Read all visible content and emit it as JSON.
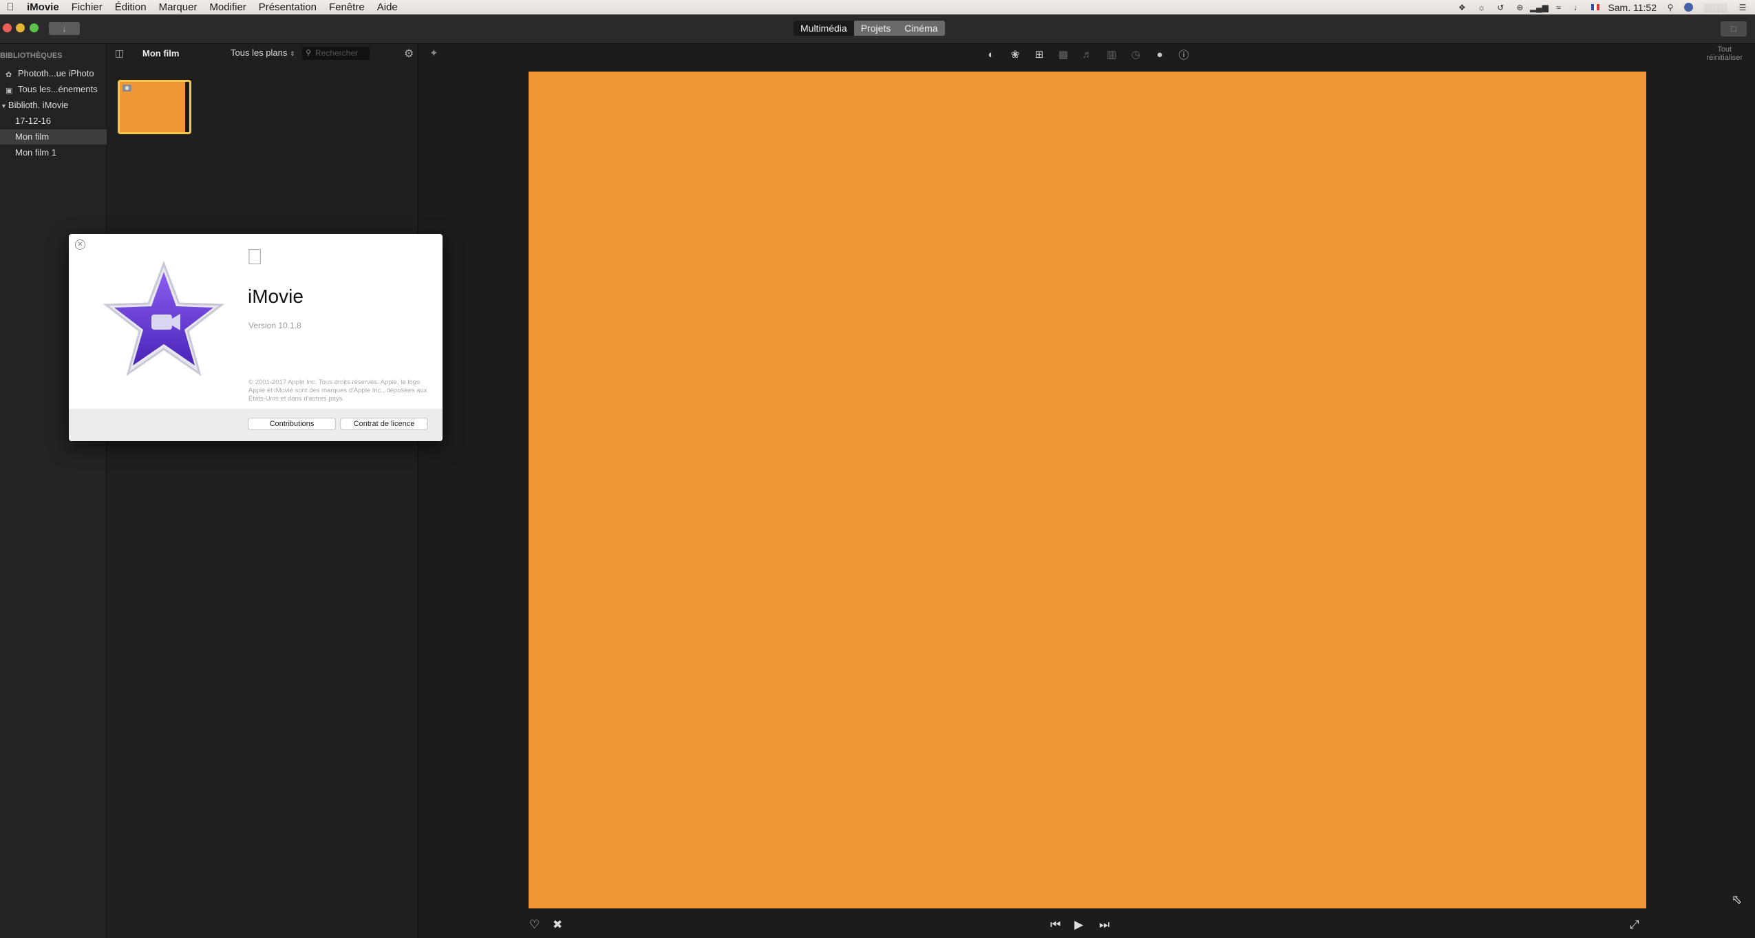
{
  "menubar": {
    "app": "iMovie",
    "items": [
      "Fichier",
      "Édition",
      "Marquer",
      "Modifier",
      "Présentation",
      "Fenêtre",
      "Aide"
    ],
    "clock": "Sam. 11:52"
  },
  "toolbar": {
    "import_icon": "↓",
    "share_icon": "share-icon",
    "modes": [
      "Multimédia",
      "Projets",
      "Cinéma"
    ],
    "active_mode": "Multimédia"
  },
  "sidebar": {
    "heading": "BIBLIOTHÈQUES",
    "items": [
      {
        "label": "Phototh...ue iPhoto",
        "icon": "photos-icon"
      },
      {
        "label": "Tous les...énements",
        "icon": "events-icon"
      },
      {
        "label": "Biblioth. iMovie",
        "icon": "disclosure-triangle-icon"
      },
      {
        "label": "17-12-16",
        "icon": ""
      },
      {
        "label": "Mon film",
        "icon": "",
        "selected": true
      },
      {
        "label": "Mon film 1",
        "icon": ""
      }
    ]
  },
  "browser": {
    "title": "Mon film",
    "filter": "Tous les plans",
    "search_placeholder": "Rechercher",
    "clip_color": "#f29737"
  },
  "viewer": {
    "reset_label_1": "Tout",
    "reset_label_2": "réinitialiser",
    "frame_color": "#f29737",
    "tools": [
      "color-balance-icon",
      "color-correction-icon",
      "crop-icon",
      "stabilization-icon",
      "volume-icon",
      "noise-reduction-icon",
      "speed-icon",
      "clip-filter-icon",
      "info-icon"
    ]
  },
  "about": {
    "app_name": "iMovie",
    "version": "Version 10.1.8",
    "copyright": "© 2001-2017 Apple Inc. Tous droits réservés. Apple, le logo Apple et iMovie sont des marques d'Apple Inc., déposées aux États-Unis et dans d'autres pays.",
    "btn_contributions": "Contributions",
    "btn_license": "Contrat de licence"
  }
}
